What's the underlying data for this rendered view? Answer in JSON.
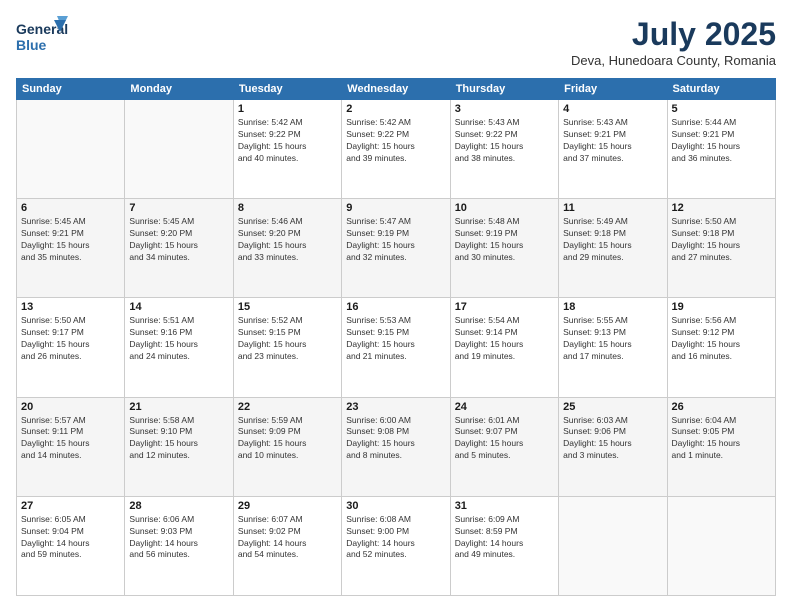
{
  "logo": {
    "line1": "General",
    "line2": "Blue"
  },
  "title": "July 2025",
  "subtitle": "Deva, Hunedoara County, Romania",
  "weekdays": [
    "Sunday",
    "Monday",
    "Tuesday",
    "Wednesday",
    "Thursday",
    "Friday",
    "Saturday"
  ],
  "weeks": [
    [
      {
        "day": "",
        "info": ""
      },
      {
        "day": "",
        "info": ""
      },
      {
        "day": "1",
        "info": "Sunrise: 5:42 AM\nSunset: 9:22 PM\nDaylight: 15 hours\nand 40 minutes."
      },
      {
        "day": "2",
        "info": "Sunrise: 5:42 AM\nSunset: 9:22 PM\nDaylight: 15 hours\nand 39 minutes."
      },
      {
        "day": "3",
        "info": "Sunrise: 5:43 AM\nSunset: 9:22 PM\nDaylight: 15 hours\nand 38 minutes."
      },
      {
        "day": "4",
        "info": "Sunrise: 5:43 AM\nSunset: 9:21 PM\nDaylight: 15 hours\nand 37 minutes."
      },
      {
        "day": "5",
        "info": "Sunrise: 5:44 AM\nSunset: 9:21 PM\nDaylight: 15 hours\nand 36 minutes."
      }
    ],
    [
      {
        "day": "6",
        "info": "Sunrise: 5:45 AM\nSunset: 9:21 PM\nDaylight: 15 hours\nand 35 minutes."
      },
      {
        "day": "7",
        "info": "Sunrise: 5:45 AM\nSunset: 9:20 PM\nDaylight: 15 hours\nand 34 minutes."
      },
      {
        "day": "8",
        "info": "Sunrise: 5:46 AM\nSunset: 9:20 PM\nDaylight: 15 hours\nand 33 minutes."
      },
      {
        "day": "9",
        "info": "Sunrise: 5:47 AM\nSunset: 9:19 PM\nDaylight: 15 hours\nand 32 minutes."
      },
      {
        "day": "10",
        "info": "Sunrise: 5:48 AM\nSunset: 9:19 PM\nDaylight: 15 hours\nand 30 minutes."
      },
      {
        "day": "11",
        "info": "Sunrise: 5:49 AM\nSunset: 9:18 PM\nDaylight: 15 hours\nand 29 minutes."
      },
      {
        "day": "12",
        "info": "Sunrise: 5:50 AM\nSunset: 9:18 PM\nDaylight: 15 hours\nand 27 minutes."
      }
    ],
    [
      {
        "day": "13",
        "info": "Sunrise: 5:50 AM\nSunset: 9:17 PM\nDaylight: 15 hours\nand 26 minutes."
      },
      {
        "day": "14",
        "info": "Sunrise: 5:51 AM\nSunset: 9:16 PM\nDaylight: 15 hours\nand 24 minutes."
      },
      {
        "day": "15",
        "info": "Sunrise: 5:52 AM\nSunset: 9:15 PM\nDaylight: 15 hours\nand 23 minutes."
      },
      {
        "day": "16",
        "info": "Sunrise: 5:53 AM\nSunset: 9:15 PM\nDaylight: 15 hours\nand 21 minutes."
      },
      {
        "day": "17",
        "info": "Sunrise: 5:54 AM\nSunset: 9:14 PM\nDaylight: 15 hours\nand 19 minutes."
      },
      {
        "day": "18",
        "info": "Sunrise: 5:55 AM\nSunset: 9:13 PM\nDaylight: 15 hours\nand 17 minutes."
      },
      {
        "day": "19",
        "info": "Sunrise: 5:56 AM\nSunset: 9:12 PM\nDaylight: 15 hours\nand 16 minutes."
      }
    ],
    [
      {
        "day": "20",
        "info": "Sunrise: 5:57 AM\nSunset: 9:11 PM\nDaylight: 15 hours\nand 14 minutes."
      },
      {
        "day": "21",
        "info": "Sunrise: 5:58 AM\nSunset: 9:10 PM\nDaylight: 15 hours\nand 12 minutes."
      },
      {
        "day": "22",
        "info": "Sunrise: 5:59 AM\nSunset: 9:09 PM\nDaylight: 15 hours\nand 10 minutes."
      },
      {
        "day": "23",
        "info": "Sunrise: 6:00 AM\nSunset: 9:08 PM\nDaylight: 15 hours\nand 8 minutes."
      },
      {
        "day": "24",
        "info": "Sunrise: 6:01 AM\nSunset: 9:07 PM\nDaylight: 15 hours\nand 5 minutes."
      },
      {
        "day": "25",
        "info": "Sunrise: 6:03 AM\nSunset: 9:06 PM\nDaylight: 15 hours\nand 3 minutes."
      },
      {
        "day": "26",
        "info": "Sunrise: 6:04 AM\nSunset: 9:05 PM\nDaylight: 15 hours\nand 1 minute."
      }
    ],
    [
      {
        "day": "27",
        "info": "Sunrise: 6:05 AM\nSunset: 9:04 PM\nDaylight: 14 hours\nand 59 minutes."
      },
      {
        "day": "28",
        "info": "Sunrise: 6:06 AM\nSunset: 9:03 PM\nDaylight: 14 hours\nand 56 minutes."
      },
      {
        "day": "29",
        "info": "Sunrise: 6:07 AM\nSunset: 9:02 PM\nDaylight: 14 hours\nand 54 minutes."
      },
      {
        "day": "30",
        "info": "Sunrise: 6:08 AM\nSunset: 9:00 PM\nDaylight: 14 hours\nand 52 minutes."
      },
      {
        "day": "31",
        "info": "Sunrise: 6:09 AM\nSunset: 8:59 PM\nDaylight: 14 hours\nand 49 minutes."
      },
      {
        "day": "",
        "info": ""
      },
      {
        "day": "",
        "info": ""
      }
    ]
  ]
}
